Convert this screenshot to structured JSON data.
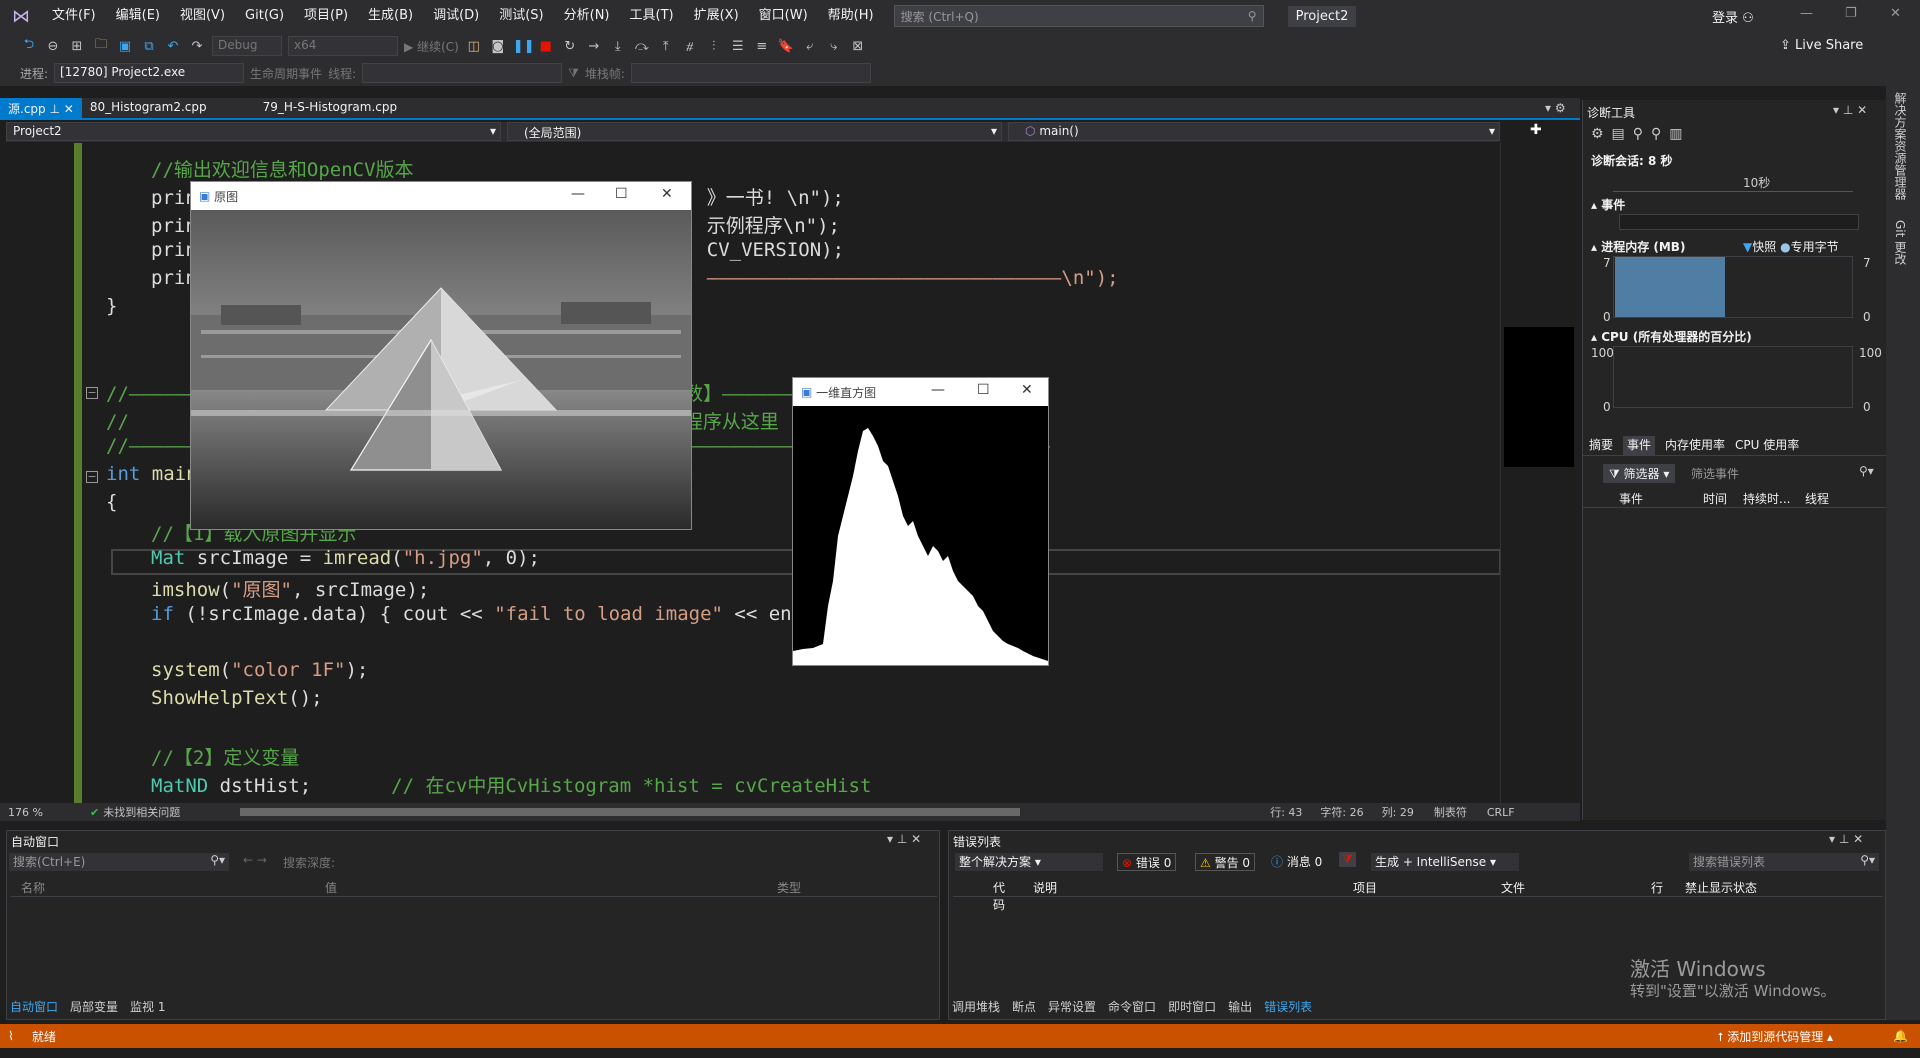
{
  "titlebar": {
    "menus": [
      "文件(F)",
      "编辑(E)",
      "视图(V)",
      "Git(G)",
      "项目(P)",
      "生成(B)",
      "调试(D)",
      "测试(S)",
      "分析(N)",
      "工具(T)",
      "扩展(X)",
      "窗口(W)",
      "帮助(H)"
    ],
    "search_placeholder": "搜索 (Ctrl+Q)",
    "solution": "Project2",
    "login": "登录"
  },
  "toolbar": {
    "config": "Debug",
    "platform": "x64",
    "continue": "继续(C)",
    "process_label": "进程:",
    "process": "[12780] Project2.exe",
    "lifecycle": "生命周期事件",
    "thread_label": "线程:",
    "stackframe_label": "堆栈帧:",
    "live_share": "Live Share"
  },
  "tabs": [
    "源.cpp",
    "80_Histogram2.cpp",
    "79_H-S-Histogram.cpp"
  ],
  "nav": {
    "project": "Project2",
    "scope": "(全局范围)",
    "func": "main()"
  },
  "code": {
    "l1": "//输出欢迎信息和OpenCV版本",
    "l2a": "prin",
    "l2b": "》一书! \\n\");",
    "l3a": "prin",
    "l3b": "示例程序\\n\");",
    "l4a": "prin",
    "l4b": "CV_VERSION);",
    "l5a": "prin",
    "l5b": "———————————————————————————————\\n\");",
    "l6": "}",
    "l7a": "//———————",
    "l7b": "数】———————————————————————————",
    "l8a": "//",
    "l8b": "程序从这里",
    "l9a": "//———————",
    "l9b": "————————————————————————————————",
    "l10a": "int",
    "l10b": "main",
    "l11": "{",
    "l12": "//【1】载入原图并显示",
    "l13a": "Mat",
    "l13b": " srcImage = ",
    "l13c": "imread",
    "l13d": "(",
    "l13e": "\"h.jpg\"",
    "l13f": ", 0);",
    "l14a": "imshow",
    "l14b": "(",
    "l14c": "\"原图\"",
    "l14d": ", srcImage);",
    "l15a": "if",
    "l15b": " (!srcImage.data) { cout << ",
    "l15c": "\"fail to load image\"",
    "l15d": " << en",
    "l16a": "system",
    "l16b": "(",
    "l16c": "\"color 1F\"",
    "l16d": ");",
    "l17a": "ShowHelpText",
    "l17b": "();",
    "l18": "//【2】定义变量",
    "l19a": "MatND",
    "l19b": " dstHist;",
    "l19c": "// 在cv中用CvHistogram *hist = cvCreateHist"
  },
  "editor_status": {
    "zoom": "176 %",
    "issues": "未找到相关问题",
    "line": "行: 43",
    "char": "字符: 26",
    "col": "列: 29",
    "tab": "制表符",
    "eol": "CRLF"
  },
  "diag": {
    "title": "诊断工具",
    "session": "诊断会话: 8 秒",
    "tick": "10秒",
    "events": "事件",
    "memory": "进程内存 (MB)",
    "snapshot": "快照",
    "private_bytes": "专用字节",
    "mem_max": "7",
    "mem_min": "0",
    "cpu": "CPU (所有处理器的百分比)",
    "cpu_max": "100",
    "cpu_min": "0",
    "tabs": [
      "摘要",
      "事件",
      "内存使用率",
      "CPU 使用率"
    ],
    "filter": "筛选器",
    "filter_placeholder": "筛选事件",
    "cols": [
      "事件",
      "时间",
      "持续时...",
      "线程"
    ]
  },
  "autos": {
    "title": "自动窗口",
    "search": "搜索(Ctrl+E)",
    "depth": "搜索深度:",
    "cols": [
      "名称",
      "值",
      "类型"
    ],
    "tabs": [
      "自动窗口",
      "局部变量",
      "监视 1"
    ]
  },
  "errors": {
    "title": "错误列表",
    "scope": "整个解决方案",
    "err": "错误 0",
    "warn": "警告 0",
    "msg": "消息 0",
    "build": "生成 + IntelliSense",
    "search": "搜索错误列表",
    "cols": [
      "代码",
      "说明",
      "项目",
      "文件",
      "行",
      "禁止显示状态"
    ],
    "tabs": [
      "调用堆栈",
      "断点",
      "异常设置",
      "命令窗口",
      "即时窗口",
      "输出",
      "错误列表"
    ]
  },
  "windows": {
    "orig": "原图",
    "hist": "一维直方图"
  },
  "status": {
    "ready": "就绪",
    "source_control": "添加到源代码管理"
  },
  "watermark": {
    "line1": "激活 Windows",
    "line2": "转到\"设置\"以激活 Windows。"
  },
  "right_rail": [
    "解决方案资源管理器",
    "Git 更改"
  ]
}
